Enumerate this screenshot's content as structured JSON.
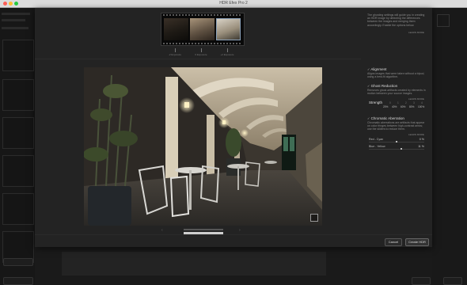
{
  "window": {
    "title": "HDR Efex Pro 2"
  },
  "filmstrip": {
    "ev_labels": [
      "-2 Exposure",
      "0 Exposure",
      "+2 Exposure"
    ]
  },
  "panel": {
    "intro_text": "The ghosting settings will guide you in creating an HDR image by detecting the differences between the images and merging them accordingly. Enable the options below.",
    "learn_more": "LEARN MORE",
    "alignment": {
      "title": "Alignment",
      "desc": "Aligns images that were taken without a tripod, using a best-fit algorithm."
    },
    "ghost": {
      "title": "Ghost Reduction",
      "desc": "Removes ghost artifacts created by elements in motion between your source images.",
      "strength_label": "Strength",
      "strength_numbers": [
        "0",
        "1",
        "2",
        "3",
        "4"
      ],
      "strength_options": [
        "20%",
        "40%",
        "60%",
        "80%",
        "100%"
      ]
    },
    "chromatic": {
      "title": "Chromatic Aberration",
      "desc": "Chromatic aberrations are artifacts that appear on color fringes between high-contrast areas; use the sliders to reduce them.",
      "sliders": [
        {
          "label": "Red - Cyan",
          "value": "0 %",
          "fraction": 0.5
        },
        {
          "label": "Blue - Yellow",
          "value": "11 %",
          "fraction": 0.58
        }
      ]
    }
  },
  "buttons": {
    "cancel": "Cancel",
    "create": "Create HDR"
  },
  "nav": {
    "prev": "‹",
    "next": "›"
  }
}
